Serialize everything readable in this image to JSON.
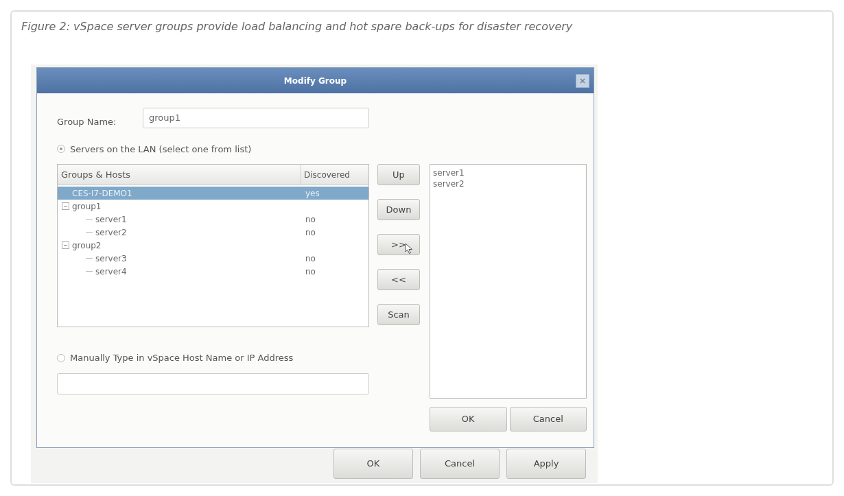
{
  "caption": "Figure 2: vSpace server groups provide load balancing and hot spare back-ups for disaster recovery",
  "dialog": {
    "title": "Modify Group",
    "group_name": {
      "label": "Group Name:",
      "value": "group1"
    },
    "source_options": [
      {
        "label": "Servers on the LAN (select one from list)",
        "selected": true
      },
      {
        "label": "Manually Type in vSpace Host Name or IP Address",
        "selected": false
      }
    ],
    "tree": {
      "columns": [
        "Groups & Hosts",
        "Discovered"
      ],
      "rows": [
        {
          "name": "CES-I7-DEMO1",
          "discovered": "yes",
          "selected": true
        },
        {
          "name": "group1",
          "expanded": true,
          "selected": false,
          "children": [
            {
              "name": "server1",
              "discovered": "no",
              "selected": false
            },
            {
              "name": "server2",
              "discovered": "no",
              "selected": false
            }
          ]
        },
        {
          "name": "group2",
          "expanded": true,
          "selected": false,
          "children": [
            {
              "name": "server3",
              "discovered": "no",
              "selected": false
            },
            {
              "name": "server4",
              "discovered": "no",
              "selected": false
            }
          ]
        }
      ]
    },
    "move_buttons": [
      "Up",
      "Down",
      ">>",
      "<<",
      "Scan"
    ],
    "selected_servers": [
      "server1",
      "server2"
    ],
    "buttons": [
      "OK",
      "Cancel"
    ]
  },
  "parent_buttons": [
    "OK",
    "Cancel",
    "Apply"
  ]
}
